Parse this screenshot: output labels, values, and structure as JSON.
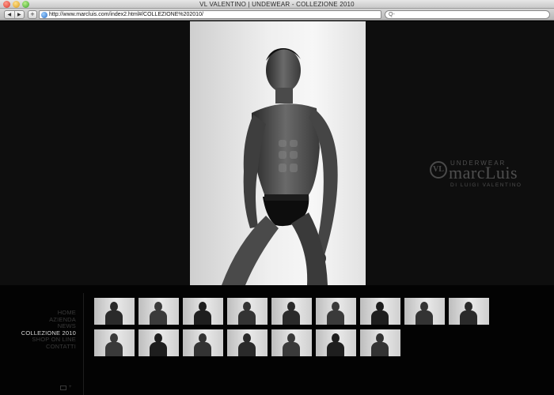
{
  "window": {
    "title": "VL VALENTINO | UNDEWEAR - COLLEZIONE 2010"
  },
  "toolbar": {
    "back_icon": "back-arrow-icon",
    "forward_icon": "forward-arrow-icon",
    "add_label": "+",
    "url": "http://www.marcluis.com/index2.html#/COLLEZIONE%202010/",
    "reload_icon": "reload-icon",
    "search_placeholder": "",
    "search_glyph": "Q-"
  },
  "logo": {
    "mark": "VL",
    "tagline": "UNDERWEAR",
    "name": "marcLuis",
    "subtitle": "DI LUIGI VALENTINO"
  },
  "menu": {
    "items": [
      {
        "label": "HOME",
        "active": false
      },
      {
        "label": "AZIENDA",
        "active": false
      },
      {
        "label": "NEWS",
        "active": false
      },
      {
        "label": "COLLEZIONE 2010",
        "active": true
      },
      {
        "label": "SHOP ON LINE",
        "active": false
      },
      {
        "label": "CONTATTI",
        "active": false
      }
    ],
    "footer_icon": "screen-icon",
    "footer_label": "+"
  },
  "gallery": {
    "rows": [
      [
        "photo-1",
        "photo-2",
        "photo-3",
        "photo-4",
        "photo-5",
        "photo-6",
        "photo-7",
        "photo-8",
        "photo-9"
      ],
      [
        "photo-10",
        "photo-11",
        "photo-12",
        "photo-13",
        "photo-14",
        "photo-15",
        "photo-16"
      ]
    ],
    "selected": "photo-1"
  },
  "colors": {
    "background": "#0e0e0e",
    "footer": "#030303",
    "menu_text": "#3a3a3a",
    "menu_active": "#d8d8d8",
    "logo": "#4e4e4e"
  }
}
